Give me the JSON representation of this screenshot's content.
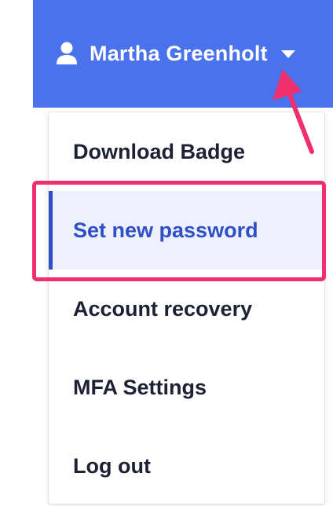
{
  "header": {
    "user_name": "Martha Greenholt",
    "user_icon": "user-icon",
    "caret_icon": "caret-down-icon",
    "background_color": "#4a72ec"
  },
  "menu": {
    "items": [
      {
        "label": "Download Badge"
      },
      {
        "label": "Set new password",
        "active": true
      },
      {
        "label": "Account recovery"
      },
      {
        "label": "MFA Settings"
      },
      {
        "label": "Log out"
      }
    ],
    "active_color": "#2f4fc4"
  },
  "annotation": {
    "highlight_color": "#f0306e",
    "highlighted_item": "Set new password"
  }
}
